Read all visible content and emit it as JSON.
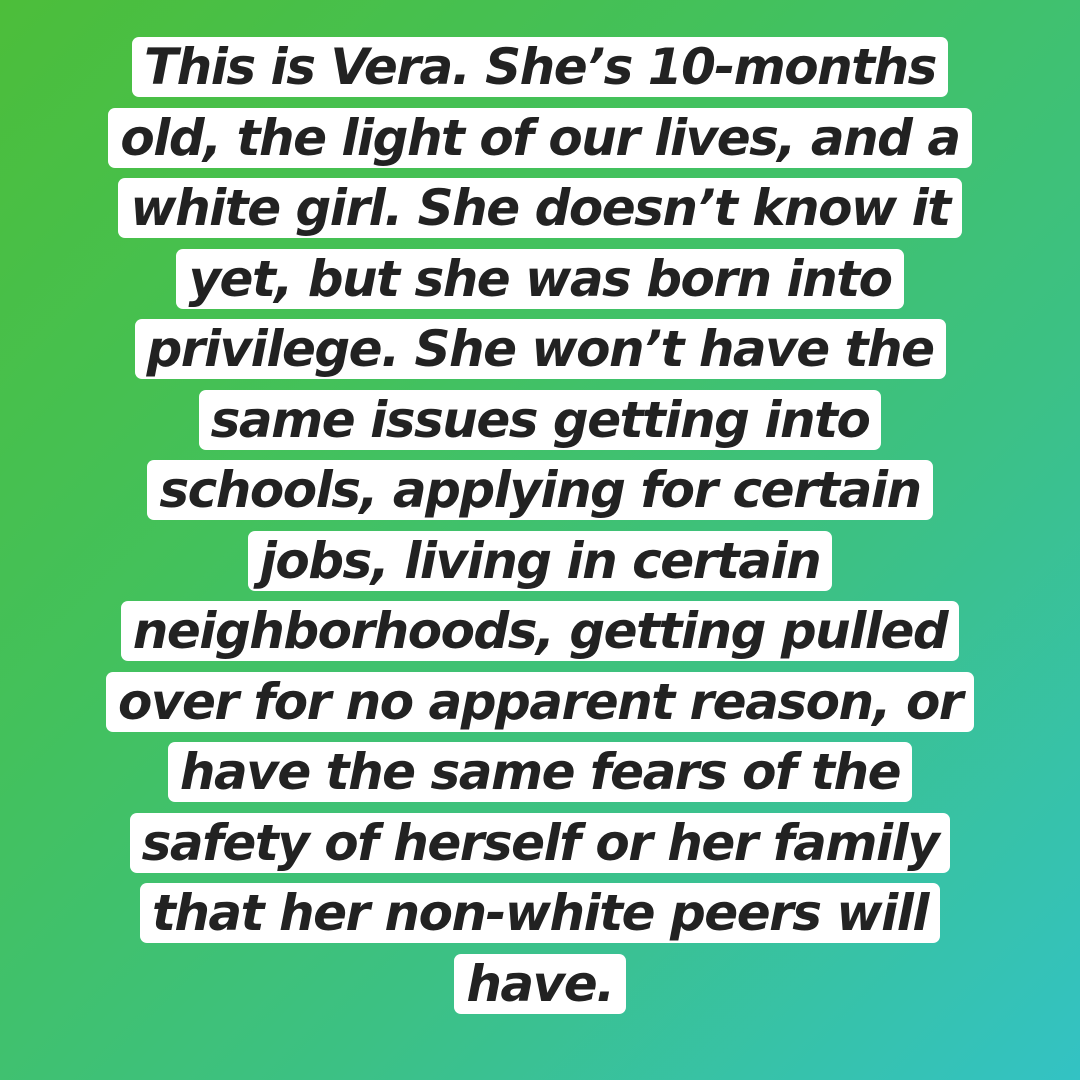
{
  "background": {
    "gradient_start": "#4cbe3a",
    "gradient_end": "#33c2c4"
  },
  "caption": {
    "text_color": "#222222",
    "highlight_color": "#ffffff",
    "lines": [
      "This is Vera.  She’s 10-months",
      "old, the light of our lives, and a",
      "white girl.  She doesn’t know it",
      "yet, but she was born into",
      "privilege.  She won’t have the",
      "same issues getting into",
      "schools, applying for certain",
      "jobs, living in certain",
      "neighborhoods, getting pulled",
      "over for no apparent reason, or",
      "have the same fears of the",
      "safety of herself or her family",
      "that her non-white peers will",
      "have."
    ]
  }
}
